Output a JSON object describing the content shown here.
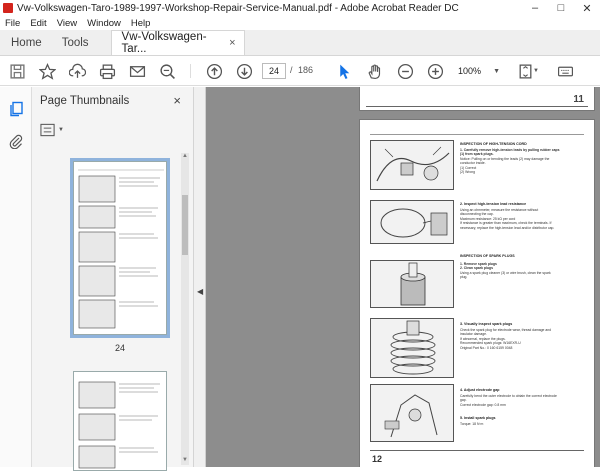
{
  "window": {
    "title": "Vw-Volkswagen-Taro-1989-1997-Workshop-Repair-Service-Manual.pdf - Adobe Acrobat Reader DC"
  },
  "menu": [
    "File",
    "Edit",
    "View",
    "Window",
    "Help"
  ],
  "tabs": {
    "home": "Home",
    "tools": "Tools",
    "doc": "Vw-Volkswagen-Tar...",
    "doc_close": "×"
  },
  "toolbar": {
    "current_page": "24",
    "separator": "/",
    "total_pages": "186",
    "zoom": "100%"
  },
  "thumbnails": {
    "title": "Page Thumbnails",
    "close": "×",
    "items": [
      {
        "label": "24"
      }
    ]
  },
  "document": {
    "top_page_number": "11",
    "bottom_page_number": "12",
    "sections": [
      {
        "title": "INSPECTION OF HIGH-TENSION CORD",
        "lines": [
          "1.  Carefully remove high-tension leads by pulling rubber caps",
          "(1) from spark plugs.",
          "Notice: Pulling on or bending the leads (2) may damage the",
          "conductor inside.",
          "(1)  Correct",
          "(2)  Wrong"
        ]
      },
      {
        "title": "2.  Inspect high-tension lead resistance",
        "lines": [
          "Using an ohmmeter, measure the resistance without",
          "disconnecting the cap.",
          "Maximum resistance:   25 kΩ per cord",
          "If resistance is greater than maximum, check the terminals. If",
          "necessary, replace the high-tension lead and/or distributor cap."
        ]
      },
      {
        "title": "INSPECTION OF SPARK PLUGS",
        "lines": [
          "1.  Remove spark plugs",
          "2.  Clean spark plugs",
          "Using a spark plug cleaner (3) or wire brush, clean the spark",
          "plug."
        ]
      },
      {
        "title": "3.  Visually inspect spark plugs",
        "lines": [
          "Check the spark plug for electrode wear, thread damage and",
          "insulator damage.",
          "If abnormal, replace the plugs.",
          "Recommended spark plugs:  W16EXR-U",
          "Original Part No.:   0 160 6159 0048"
        ]
      },
      {
        "title": "4.  Adjust electrode gap",
        "lines": [
          "Carefully bend the outer electrode to obtain the correct electrode",
          "gap.",
          "Correct electrode gap:  0.8 mm"
        ]
      },
      {
        "title": "5.  Install spark plugs",
        "lines": [
          "Torque:   18 N·m"
        ]
      }
    ]
  },
  "colors": {
    "accent": "#1473e6",
    "acrobat_red": "#d3241c",
    "doc_background": "#8d8d8d",
    "thumb_selection": "#8fb3dc"
  },
  "icons": {
    "save": "save-icon",
    "bookmark": "star-icon",
    "upload": "upload-icon",
    "print": "print-icon",
    "mail": "mail-icon",
    "search": "search-zoom-icon",
    "prev": "page-up-icon",
    "next": "page-down-icon",
    "select": "cursor-arrow-icon",
    "hand": "hand-icon",
    "zoom_out": "zoom-out-icon",
    "zoom_in": "zoom-in-icon",
    "fit": "fit-page-icon",
    "keyboard": "keyboard-icon"
  }
}
